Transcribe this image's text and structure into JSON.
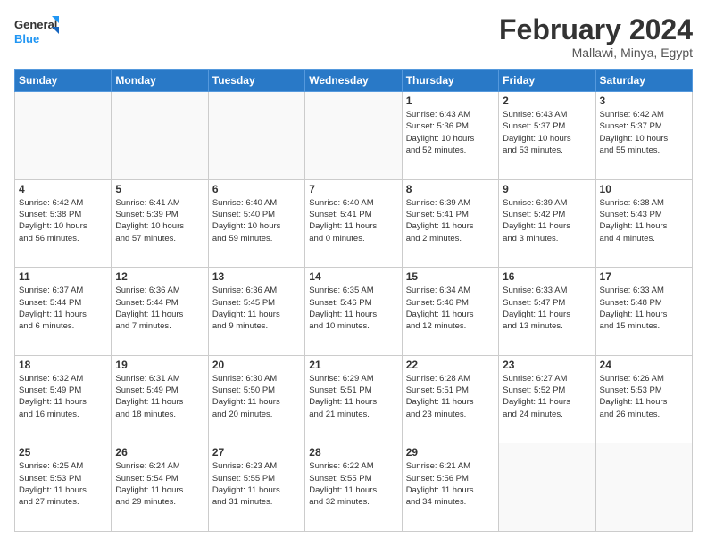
{
  "logo": {
    "line1": "General",
    "line2": "Blue"
  },
  "title": {
    "main": "February 2024",
    "sub": "Mallawi, Minya, Egypt"
  },
  "weekdays": [
    "Sunday",
    "Monday",
    "Tuesday",
    "Wednesday",
    "Thursday",
    "Friday",
    "Saturday"
  ],
  "weeks": [
    [
      {
        "day": "",
        "info": ""
      },
      {
        "day": "",
        "info": ""
      },
      {
        "day": "",
        "info": ""
      },
      {
        "day": "",
        "info": ""
      },
      {
        "day": "1",
        "info": "Sunrise: 6:43 AM\nSunset: 5:36 PM\nDaylight: 10 hours\nand 52 minutes."
      },
      {
        "day": "2",
        "info": "Sunrise: 6:43 AM\nSunset: 5:37 PM\nDaylight: 10 hours\nand 53 minutes."
      },
      {
        "day": "3",
        "info": "Sunrise: 6:42 AM\nSunset: 5:37 PM\nDaylight: 10 hours\nand 55 minutes."
      }
    ],
    [
      {
        "day": "4",
        "info": "Sunrise: 6:42 AM\nSunset: 5:38 PM\nDaylight: 10 hours\nand 56 minutes."
      },
      {
        "day": "5",
        "info": "Sunrise: 6:41 AM\nSunset: 5:39 PM\nDaylight: 10 hours\nand 57 minutes."
      },
      {
        "day": "6",
        "info": "Sunrise: 6:40 AM\nSunset: 5:40 PM\nDaylight: 10 hours\nand 59 minutes."
      },
      {
        "day": "7",
        "info": "Sunrise: 6:40 AM\nSunset: 5:41 PM\nDaylight: 11 hours\nand 0 minutes."
      },
      {
        "day": "8",
        "info": "Sunrise: 6:39 AM\nSunset: 5:41 PM\nDaylight: 11 hours\nand 2 minutes."
      },
      {
        "day": "9",
        "info": "Sunrise: 6:39 AM\nSunset: 5:42 PM\nDaylight: 11 hours\nand 3 minutes."
      },
      {
        "day": "10",
        "info": "Sunrise: 6:38 AM\nSunset: 5:43 PM\nDaylight: 11 hours\nand 4 minutes."
      }
    ],
    [
      {
        "day": "11",
        "info": "Sunrise: 6:37 AM\nSunset: 5:44 PM\nDaylight: 11 hours\nand 6 minutes."
      },
      {
        "day": "12",
        "info": "Sunrise: 6:36 AM\nSunset: 5:44 PM\nDaylight: 11 hours\nand 7 minutes."
      },
      {
        "day": "13",
        "info": "Sunrise: 6:36 AM\nSunset: 5:45 PM\nDaylight: 11 hours\nand 9 minutes."
      },
      {
        "day": "14",
        "info": "Sunrise: 6:35 AM\nSunset: 5:46 PM\nDaylight: 11 hours\nand 10 minutes."
      },
      {
        "day": "15",
        "info": "Sunrise: 6:34 AM\nSunset: 5:46 PM\nDaylight: 11 hours\nand 12 minutes."
      },
      {
        "day": "16",
        "info": "Sunrise: 6:33 AM\nSunset: 5:47 PM\nDaylight: 11 hours\nand 13 minutes."
      },
      {
        "day": "17",
        "info": "Sunrise: 6:33 AM\nSunset: 5:48 PM\nDaylight: 11 hours\nand 15 minutes."
      }
    ],
    [
      {
        "day": "18",
        "info": "Sunrise: 6:32 AM\nSunset: 5:49 PM\nDaylight: 11 hours\nand 16 minutes."
      },
      {
        "day": "19",
        "info": "Sunrise: 6:31 AM\nSunset: 5:49 PM\nDaylight: 11 hours\nand 18 minutes."
      },
      {
        "day": "20",
        "info": "Sunrise: 6:30 AM\nSunset: 5:50 PM\nDaylight: 11 hours\nand 20 minutes."
      },
      {
        "day": "21",
        "info": "Sunrise: 6:29 AM\nSunset: 5:51 PM\nDaylight: 11 hours\nand 21 minutes."
      },
      {
        "day": "22",
        "info": "Sunrise: 6:28 AM\nSunset: 5:51 PM\nDaylight: 11 hours\nand 23 minutes."
      },
      {
        "day": "23",
        "info": "Sunrise: 6:27 AM\nSunset: 5:52 PM\nDaylight: 11 hours\nand 24 minutes."
      },
      {
        "day": "24",
        "info": "Sunrise: 6:26 AM\nSunset: 5:53 PM\nDaylight: 11 hours\nand 26 minutes."
      }
    ],
    [
      {
        "day": "25",
        "info": "Sunrise: 6:25 AM\nSunset: 5:53 PM\nDaylight: 11 hours\nand 27 minutes."
      },
      {
        "day": "26",
        "info": "Sunrise: 6:24 AM\nSunset: 5:54 PM\nDaylight: 11 hours\nand 29 minutes."
      },
      {
        "day": "27",
        "info": "Sunrise: 6:23 AM\nSunset: 5:55 PM\nDaylight: 11 hours\nand 31 minutes."
      },
      {
        "day": "28",
        "info": "Sunrise: 6:22 AM\nSunset: 5:55 PM\nDaylight: 11 hours\nand 32 minutes."
      },
      {
        "day": "29",
        "info": "Sunrise: 6:21 AM\nSunset: 5:56 PM\nDaylight: 11 hours\nand 34 minutes."
      },
      {
        "day": "",
        "info": ""
      },
      {
        "day": "",
        "info": ""
      }
    ]
  ]
}
